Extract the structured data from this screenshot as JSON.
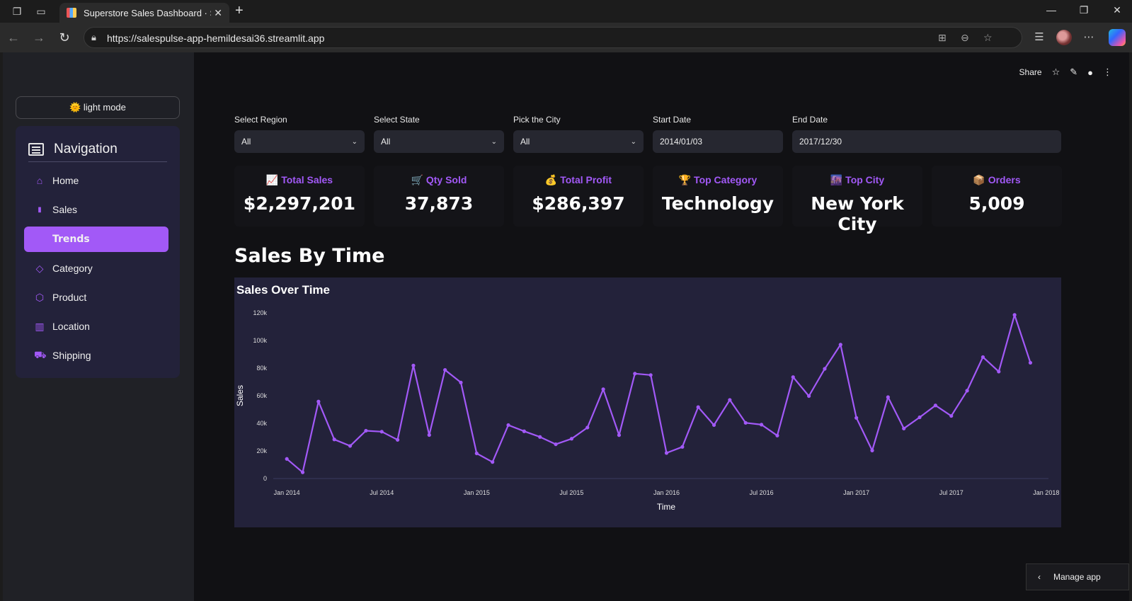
{
  "browser": {
    "tab_title": "Superstore Sales Dashboard · Stre",
    "url": "https://salespulse-app-hemildesai36.streamlit.app"
  },
  "sidebar": {
    "mode_button": "🌞 light mode",
    "nav_title": "Navigation",
    "items": [
      {
        "label": "Home",
        "icon": "home-icon",
        "glyph": "⌂"
      },
      {
        "label": "Sales",
        "icon": "bar-chart-icon",
        "glyph": "▮"
      },
      {
        "label": "Trends",
        "icon": "trend-icon",
        "glyph": ""
      },
      {
        "label": "Category",
        "icon": "layers-icon",
        "glyph": "◇"
      },
      {
        "label": "Product",
        "icon": "box-icon",
        "glyph": "⬡"
      },
      {
        "label": "Location",
        "icon": "map-icon",
        "glyph": "▥"
      },
      {
        "label": "Shipping",
        "icon": "truck-icon",
        "glyph": "⛟"
      }
    ],
    "active_item": "Trends"
  },
  "toolbar": {
    "share_label": "Share"
  },
  "filters": [
    {
      "label": "Select Region",
      "value": "All",
      "type": "select"
    },
    {
      "label": "Select State",
      "value": "All",
      "type": "select"
    },
    {
      "label": "Pick the City",
      "value": "All",
      "type": "select"
    },
    {
      "label": "Start Date",
      "value": "2014/01/03",
      "type": "date"
    },
    {
      "label": "End Date",
      "value": "2017/12/30",
      "type": "date"
    }
  ],
  "kpis": [
    {
      "label": "📈 Total Sales",
      "value": "$2,297,201"
    },
    {
      "label": "🛒 Qty Sold",
      "value": "37,873"
    },
    {
      "label": "💰 Total Profit",
      "value": "$286,397"
    },
    {
      "label": "🏆 Top Category",
      "value": "Technology"
    },
    {
      "label": "🌆 Top City",
      "value": "New York City"
    },
    {
      "label": "📦 Orders",
      "value": "5,009"
    }
  ],
  "section_title": "Sales By Time",
  "manage_app": "Manage app",
  "colors": {
    "accent": "#a259f7",
    "panel": "#23223a",
    "background": "#111114"
  },
  "chart_data": {
    "type": "line",
    "title": "Sales Over Time",
    "xlabel": "Time",
    "ylabel": "Sales",
    "ylim": [
      0,
      125000
    ],
    "y_ticks": [
      0,
      20000,
      40000,
      60000,
      80000,
      100000,
      120000
    ],
    "y_tick_labels": [
      "0",
      "20k",
      "40k",
      "60k",
      "80k",
      "100k",
      "120k"
    ],
    "x_ticks": [
      "2014-01",
      "2014-07",
      "2015-01",
      "2015-07",
      "2016-01",
      "2016-07",
      "2017-01",
      "2017-07",
      "2018-01"
    ],
    "x_tick_labels": [
      "Jan 2014",
      "Jul 2014",
      "Jan 2015",
      "Jul 2015",
      "Jan 2016",
      "Jul 2016",
      "Jan 2017",
      "Jul 2017",
      "Jan 2018"
    ],
    "x": [
      "2014-01",
      "2014-02",
      "2014-03",
      "2014-04",
      "2014-05",
      "2014-06",
      "2014-07",
      "2014-08",
      "2014-09",
      "2014-10",
      "2014-11",
      "2014-12",
      "2015-01",
      "2015-02",
      "2015-03",
      "2015-04",
      "2015-05",
      "2015-06",
      "2015-07",
      "2015-08",
      "2015-09",
      "2015-10",
      "2015-11",
      "2015-12",
      "2016-01",
      "2016-02",
      "2016-03",
      "2016-04",
      "2016-05",
      "2016-06",
      "2016-07",
      "2016-08",
      "2016-09",
      "2016-10",
      "2016-11",
      "2016-12",
      "2017-01",
      "2017-02",
      "2017-03",
      "2017-04",
      "2017-05",
      "2017-06",
      "2017-07",
      "2017-08",
      "2017-09",
      "2017-10",
      "2017-11",
      "2017-12"
    ],
    "values": [
      14200,
      4500,
      55700,
      28300,
      23600,
      34600,
      33900,
      28000,
      81800,
      31500,
      78600,
      69500,
      18200,
      11950,
      38700,
      34200,
      30100,
      24800,
      28800,
      36900,
      64600,
      31400,
      75900,
      74900,
      18500,
      22900,
      51700,
      38700,
      56900,
      40300,
      39000,
      31100,
      73400,
      59700,
      79400,
      96900,
      43900,
      20300,
      58900,
      36200,
      44300,
      52900,
      45300,
      63600,
      87900,
      77400,
      118400,
      83800
    ],
    "line_color": "#a259f7",
    "grid": false
  }
}
